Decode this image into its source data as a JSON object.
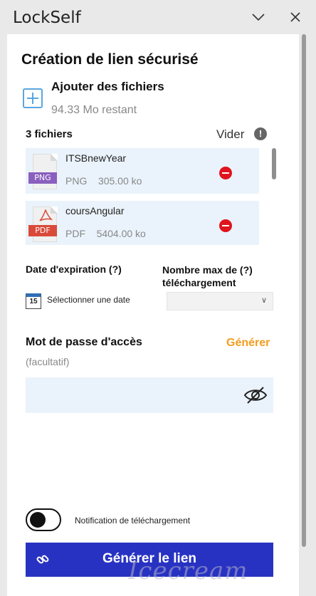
{
  "window": {
    "title": "LockSelf",
    "minimize_glyph": "∨",
    "close_glyph": "✕"
  },
  "main": {
    "heading": "Création de lien sécurisé",
    "add_files_label": "Ajouter des fichiers",
    "remaining": "94.33 Mo restant",
    "file_count": "3 fichiers",
    "clear_label": "Vider",
    "files": [
      {
        "name": "ITSBnewYear",
        "type": "PNG",
        "size": "305.00 ko",
        "tag": "PNG",
        "tag_color": "#8a5fbf"
      },
      {
        "name": "coursAngular",
        "type": "PDF",
        "size": "5404.00 ko",
        "tag": "PDF",
        "tag_color": "#d94a3a"
      }
    ],
    "expiration_label": "Date d'expiration (?)",
    "max_download_label": "Nombre max de (?) téléchargement",
    "date_placeholder": "Sélectionner une date",
    "calendar_day": "15",
    "password_title": "Mot de passe d'accès",
    "generate_link": "Générer",
    "optional_label": "(facultatif)",
    "notification_label": "Notification de téléchargement",
    "submit_label": "Générer le lien"
  },
  "watermark": {
    "text": "Icecream"
  },
  "colors": {
    "accent_blue": "#2832c2",
    "accent_orange": "#f39c1f",
    "light_blue": "#eaf3fb",
    "remove_red": "#e0141e"
  }
}
